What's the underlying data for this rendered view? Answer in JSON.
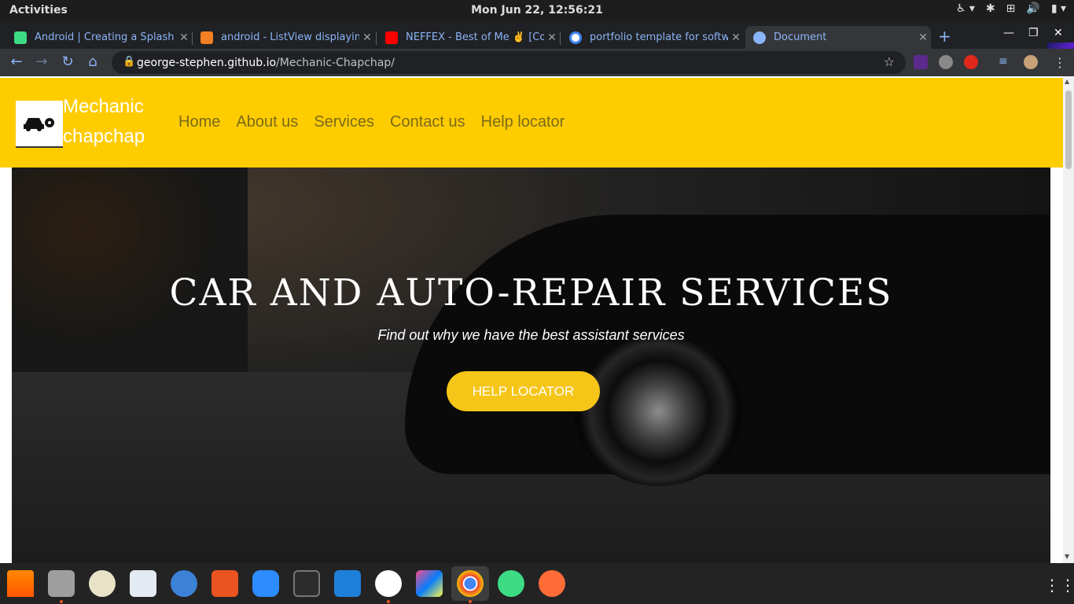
{
  "system": {
    "activities_label": "Activities",
    "clock": "Mon Jun 22, 12:56:21"
  },
  "browser": {
    "tabs": [
      {
        "title": "Android | Creating a Splash S",
        "favicon_color": "#3ddc84"
      },
      {
        "title": "android - ListView displaying",
        "favicon_color": "#f48024"
      },
      {
        "title": "NEFFEX - Best of Me ✌️ [Cop",
        "favicon_color": "#ff0000"
      },
      {
        "title": "portfolio template for softw",
        "favicon_color": "#4285f4"
      },
      {
        "title": "Document",
        "favicon_color": "#8ab4f8"
      }
    ],
    "new_tab_label": "+",
    "url_host": "george-stephen.github.io",
    "url_path": "/Mechanic-Chapchap/"
  },
  "site": {
    "brand_line1": "Mechanic",
    "brand_line2": "chapchap",
    "nav": [
      "Home",
      "About us",
      "Services",
      "Contact us",
      "Help locator"
    ],
    "hero_title": "CAR AND AUTO-REPAIR SERVICES",
    "hero_subtitle": "Find out why we have the best assistant services",
    "cta_label": "HELP LOCATOR",
    "colors": {
      "navbar": "#ffcc00",
      "cta": "#f5c518"
    }
  },
  "dock": {
    "apps": [
      "vlc-icon",
      "files-icon",
      "rhythmbox-icon",
      "text-editor-icon",
      "help-icon",
      "software-center-icon",
      "zoom-icon",
      "terminal-icon",
      "vscode-icon",
      "slack-icon",
      "intellij-icon",
      "chrome-icon",
      "android-studio-icon",
      "postman-icon"
    ]
  }
}
